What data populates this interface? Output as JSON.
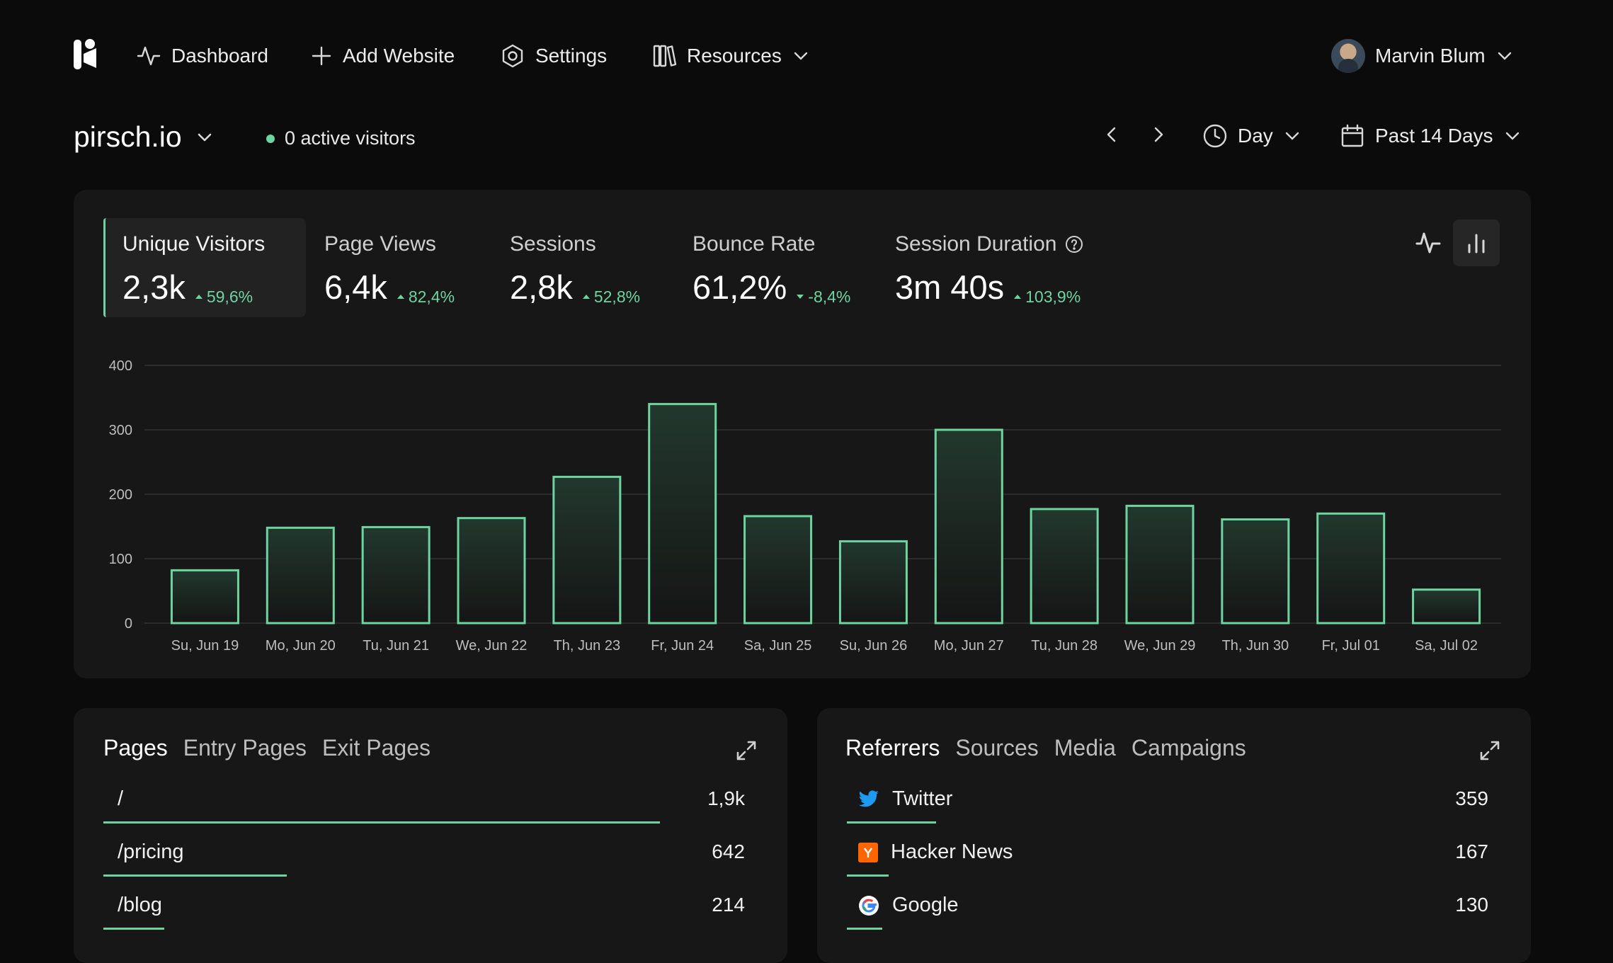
{
  "nav": {
    "dashboard": "Dashboard",
    "add_website": "Add Website",
    "settings": "Settings",
    "resources": "Resources",
    "user_name": "Marvin Blum"
  },
  "header": {
    "site": "pirsch.io",
    "active_visitors": "0 active visitors",
    "interval": "Day",
    "range": "Past 14 Days"
  },
  "metrics": [
    {
      "label": "Unique Visitors",
      "value": "2,3k",
      "delta": "59,6%",
      "direction": "up",
      "selected": true
    },
    {
      "label": "Page Views",
      "value": "6,4k",
      "delta": "82,4%",
      "direction": "up"
    },
    {
      "label": "Sessions",
      "value": "2,8k",
      "delta": "52,8%",
      "direction": "up"
    },
    {
      "label": "Bounce Rate",
      "value": "61,2%",
      "delta": "-8,4%",
      "direction": "down"
    },
    {
      "label": "Session Duration",
      "value": "3m 40s",
      "delta": "103,9%",
      "direction": "up"
    }
  ],
  "chart_data": {
    "type": "bar",
    "categories": [
      "Su, Jun 19",
      "Mo, Jun 20",
      "Tu, Jun 21",
      "We, Jun 22",
      "Th, Jun 23",
      "Fr, Jun 24",
      "Sa, Jun 25",
      "Su, Jun 26",
      "Mo, Jun 27",
      "Tu, Jun 28",
      "We, Jun 29",
      "Th, Jun 30",
      "Fr, Jul 01",
      "Sa, Jul 02"
    ],
    "values": [
      82,
      148,
      149,
      163,
      227,
      340,
      166,
      127,
      300,
      177,
      182,
      161,
      170,
      52
    ],
    "yticks": [
      0,
      100,
      200,
      300,
      400
    ],
    "ylim": [
      0,
      400
    ],
    "grid": true,
    "bar_color": "#6fd3a0"
  },
  "pages": {
    "tabs": [
      "Pages",
      "Entry Pages",
      "Exit Pages"
    ],
    "rows": [
      {
        "label": "/",
        "value": "1,9k",
        "fraction": 1.0
      },
      {
        "label": "/pricing",
        "value": "642",
        "fraction": 0.33
      },
      {
        "label": "/blog",
        "value": "214",
        "fraction": 0.11
      }
    ]
  },
  "referrers": {
    "tabs": [
      "Referrers",
      "Sources",
      "Media",
      "Campaigns"
    ],
    "rows": [
      {
        "label": "Twitter",
        "value": "359",
        "fraction": 0.16,
        "icon": "twitter-icon"
      },
      {
        "label": "Hacker News",
        "value": "167",
        "fraction": 0.075,
        "icon": "hacker-news-icon"
      },
      {
        "label": "Google",
        "value": "130",
        "fraction": 0.058,
        "icon": "google-icon"
      }
    ]
  },
  "colors": {
    "accent": "#6fd3a0",
    "background": "#0b0b0b",
    "card": "#171717"
  }
}
